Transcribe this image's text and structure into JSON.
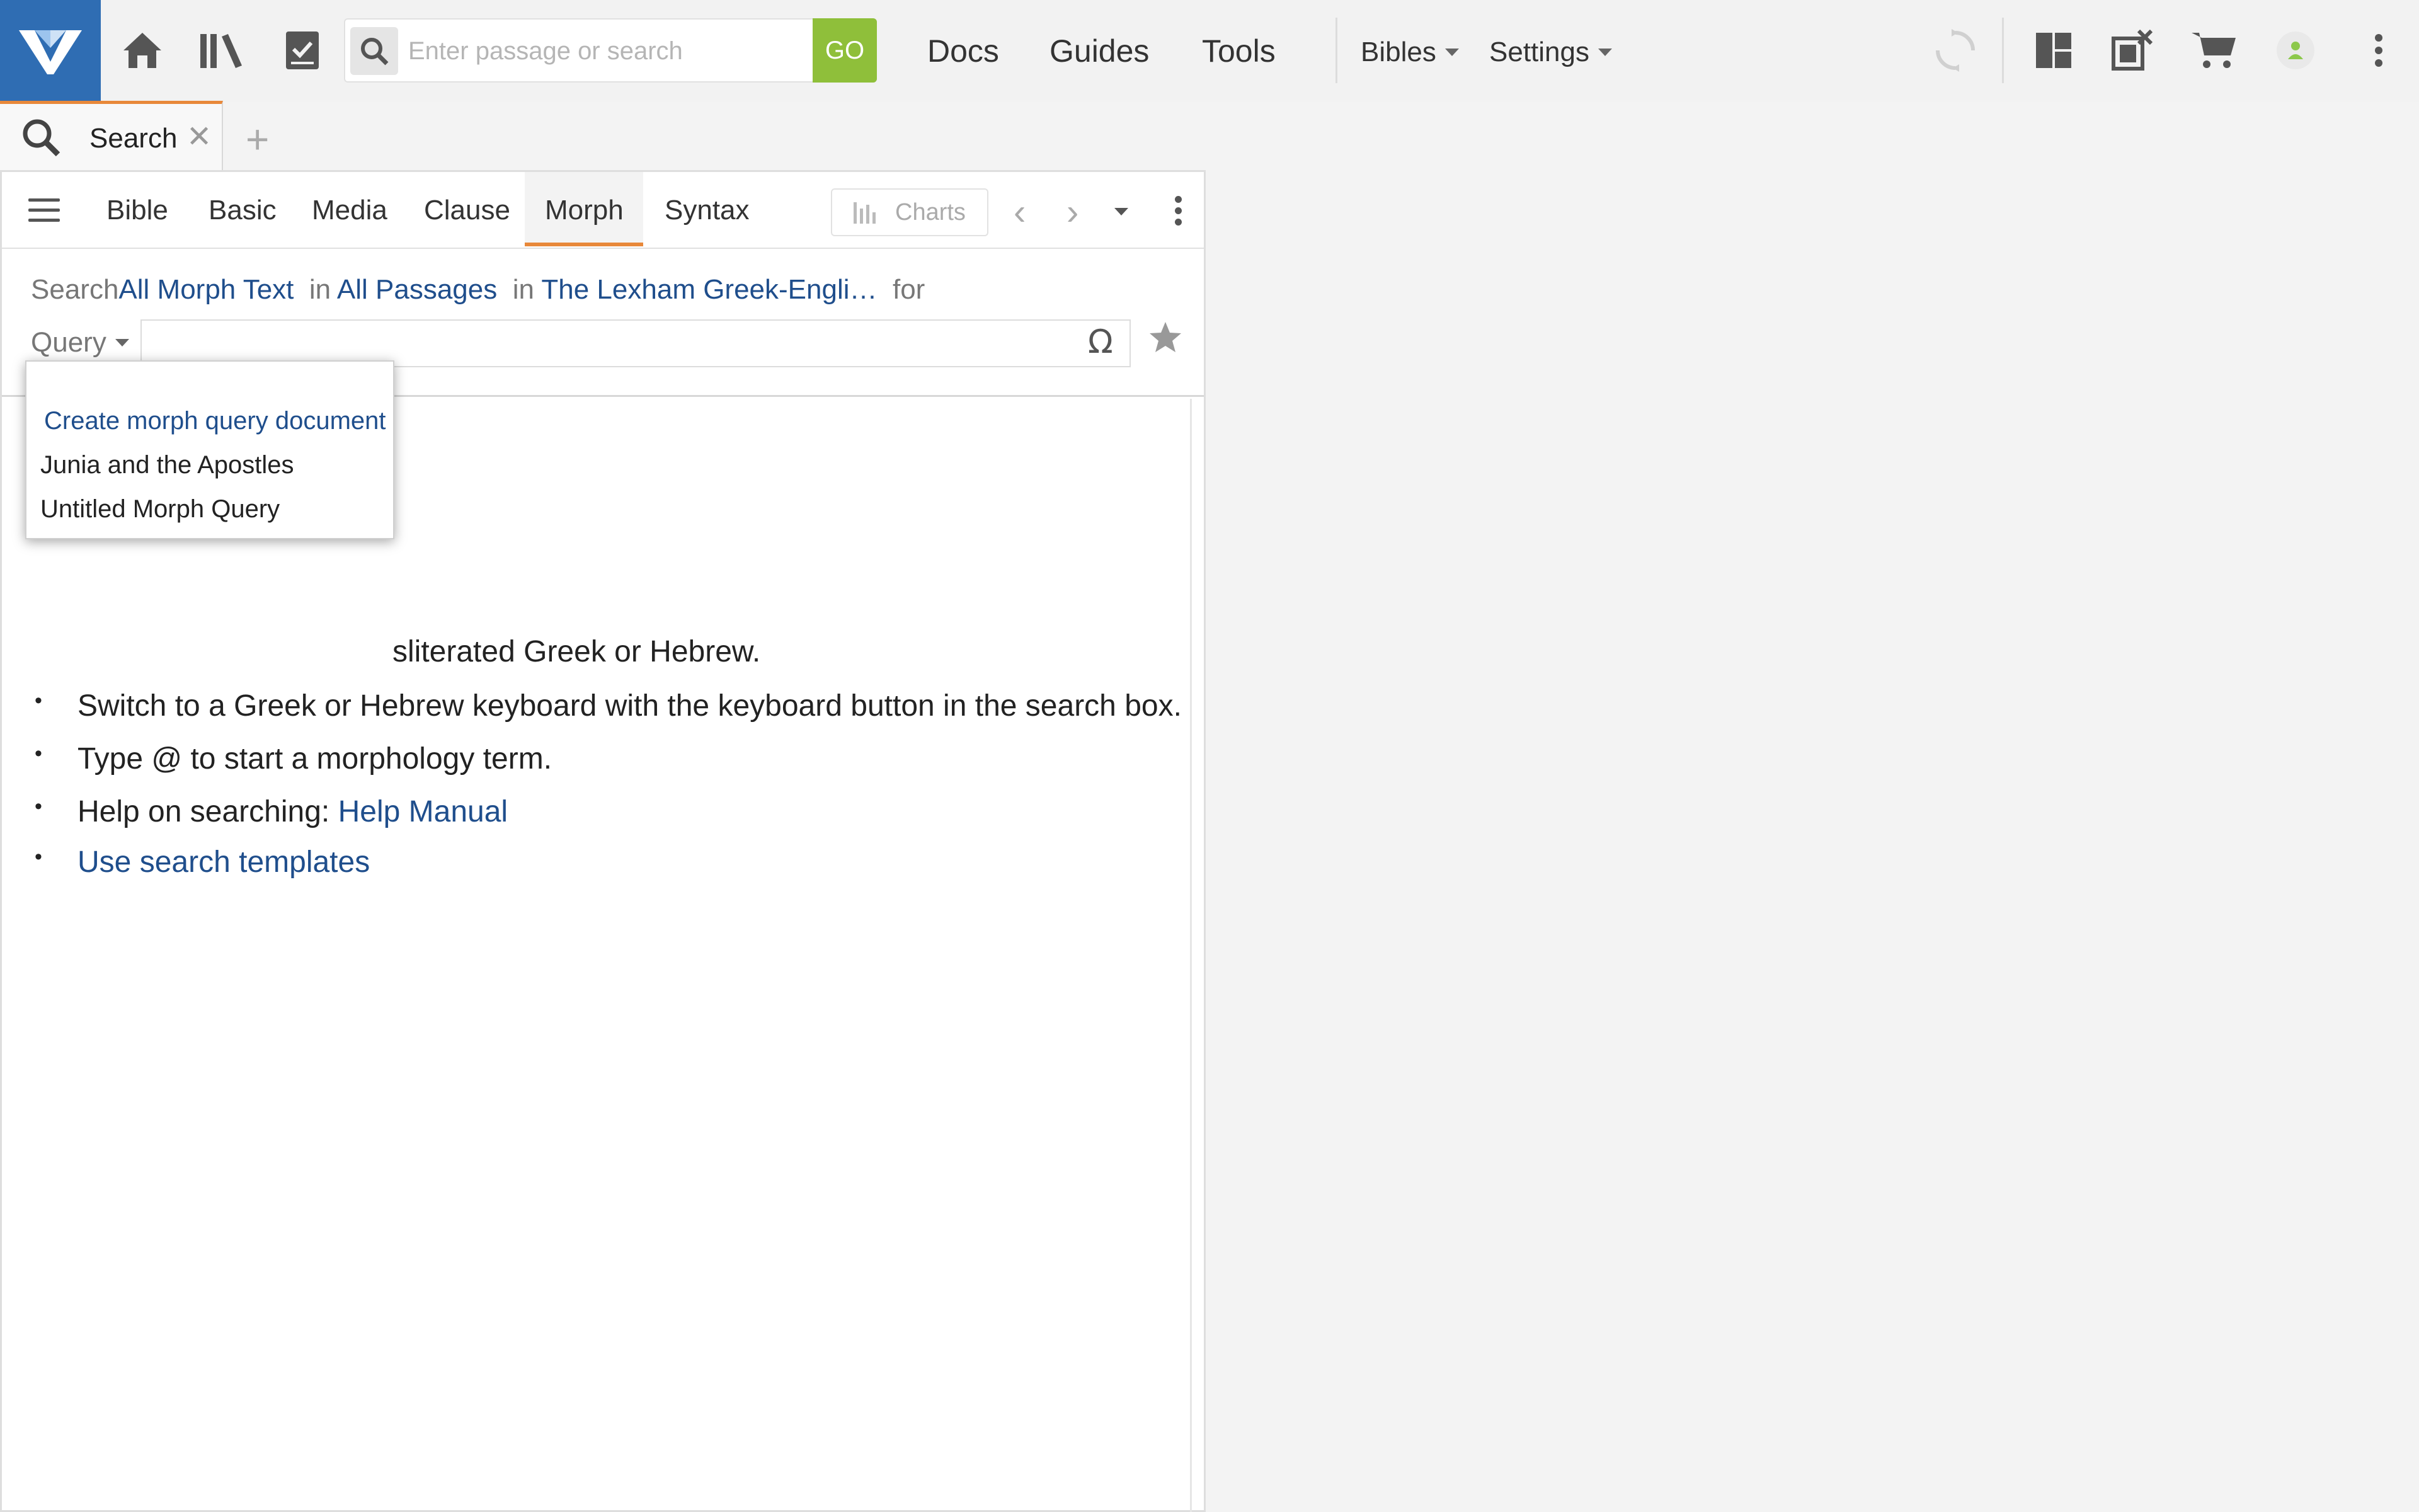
{
  "topbar": {
    "search_placeholder": "Enter passage or search",
    "go_label": "GO",
    "nav": [
      "Docs",
      "Guides",
      "Tools"
    ],
    "bibles_label": "Bibles",
    "settings_label": "Settings",
    "icons": [
      "home-icon",
      "library-icon",
      "checklist-icon",
      "sync-icon",
      "layouts-icon",
      "close-panels-icon",
      "cart-icon",
      "account-icon",
      "more-icon"
    ],
    "colors": {
      "brand": "#2f6db3",
      "go": "#8fbf3a",
      "account_online": "#8cc84b"
    }
  },
  "tab": {
    "label": "Search"
  },
  "panel": {
    "tabs": [
      "Bible",
      "Basic",
      "Media",
      "Clause",
      "Morph",
      "Syntax"
    ],
    "active_tab": "Morph",
    "charts_label": "Charts",
    "search_line": {
      "prefix": "Search",
      "what": "All Morph Text",
      "in1": "in",
      "where": "All Passages",
      "in2": "in",
      "resource": "The Lexham Greek-Engli…",
      "for": "for"
    },
    "query_label": "Query",
    "query_value": "",
    "omega": "Ω",
    "tips": [
      {
        "text": "sliterated Greek or Hebrew."
      },
      {
        "text": "Switch to a Greek or Hebrew keyboard with the keyboard button in the search box."
      },
      {
        "text": "Type @ to start a morphology term."
      },
      {
        "prefix": "Help on searching: ",
        "link": "Help Manual"
      },
      {
        "link": "Use search templates"
      }
    ],
    "accent": "#e8883a",
    "link_color": "#1f4e8c"
  },
  "query_dropdown": {
    "create": "Create morph query document",
    "items": [
      "Junia and the Apostles",
      "Untitled Morph Query"
    ]
  }
}
